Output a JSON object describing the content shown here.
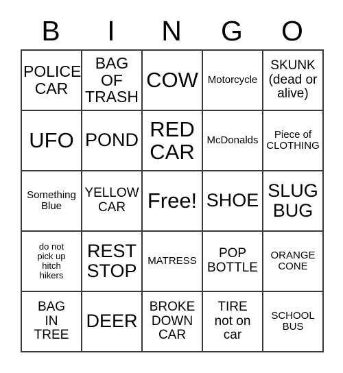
{
  "card": {
    "header": {
      "letters": [
        "B",
        "I",
        "N",
        "G",
        "O"
      ]
    },
    "grid": {
      "rows": 5,
      "columns": 5,
      "cells": [
        {
          "text": "POLICE\nCAR",
          "size": "lg",
          "free": false
        },
        {
          "text": "BAG\nOF\nTRASH",
          "size": "lg",
          "free": false
        },
        {
          "text": "COW",
          "size": "xxl",
          "free": false
        },
        {
          "text": "Motorcycle",
          "size": "sm",
          "free": false
        },
        {
          "text": "SKUNK\n(dead or\nalive)",
          "size": "md",
          "free": false
        },
        {
          "text": "UFO",
          "size": "xxl",
          "free": false
        },
        {
          "text": "POND",
          "size": "xl",
          "free": false
        },
        {
          "text": "RED\nCAR",
          "size": "xxl",
          "free": false
        },
        {
          "text": "McDonalds",
          "size": "sm",
          "free": false
        },
        {
          "text": "Piece of\nCLOTHING",
          "size": "sm",
          "free": false
        },
        {
          "text": "Something\nBlue",
          "size": "sm",
          "free": false
        },
        {
          "text": "YELLOW\nCAR",
          "size": "md",
          "free": false
        },
        {
          "text": "Free!",
          "size": "xxl",
          "free": true
        },
        {
          "text": "SHOE",
          "size": "xl",
          "free": false
        },
        {
          "text": "SLUG\nBUG",
          "size": "xl",
          "free": false
        },
        {
          "text": "do not\npick up\nhitch\nhikers",
          "size": "xs",
          "free": false
        },
        {
          "text": "REST\nSTOP",
          "size": "xl",
          "free": false
        },
        {
          "text": "MATRESS",
          "size": "sm",
          "free": false
        },
        {
          "text": "POP\nBOTTLE",
          "size": "md",
          "free": false
        },
        {
          "text": "ORANGE\nCONE",
          "size": "sm",
          "free": false
        },
        {
          "text": "BAG\nIN\nTREE",
          "size": "md",
          "free": false
        },
        {
          "text": "DEER",
          "size": "xl",
          "free": false
        },
        {
          "text": "BROKE\nDOWN\nCAR",
          "size": "md",
          "free": false
        },
        {
          "text": "TIRE\nnot on\ncar",
          "size": "md",
          "free": false
        },
        {
          "text": "SCHOOL\nBUS",
          "size": "sm",
          "free": false
        }
      ]
    }
  }
}
